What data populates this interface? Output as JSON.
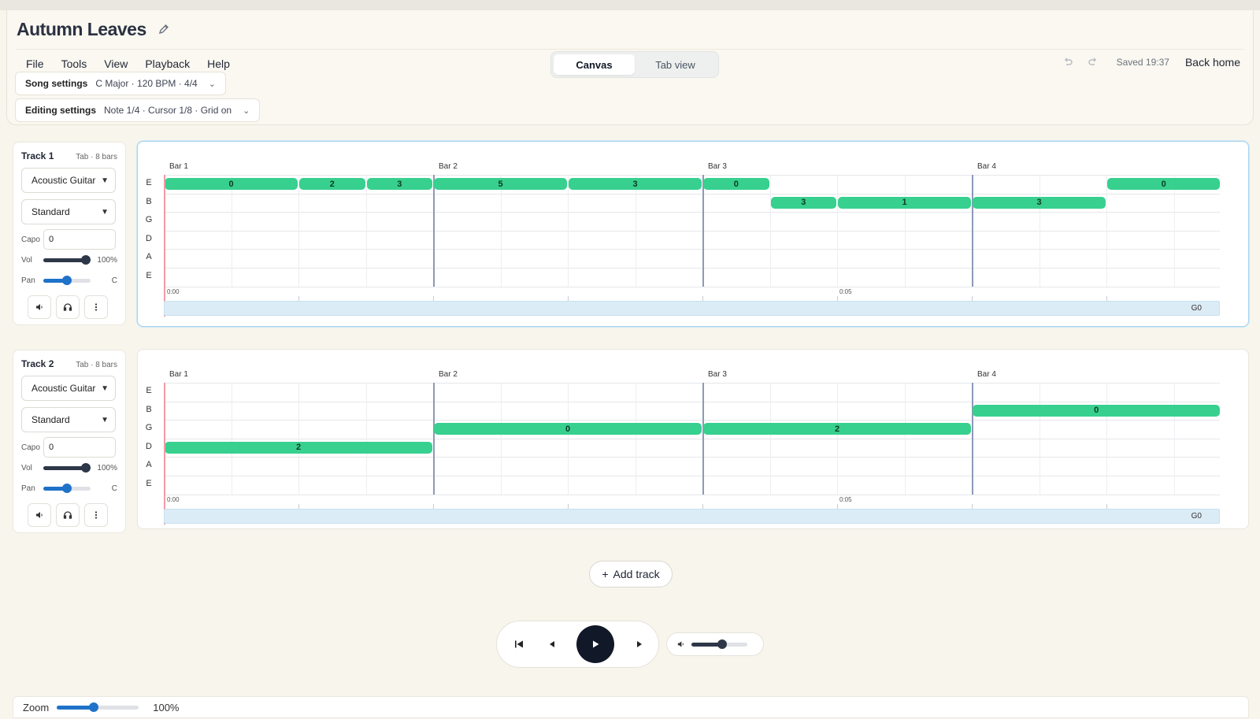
{
  "header": {
    "title": "Autumn Leaves",
    "menu": [
      "File",
      "Tools",
      "View",
      "Playback",
      "Help"
    ],
    "view_toggle": [
      "Canvas",
      "Tab view"
    ],
    "saved": "Saved 19:37",
    "back_home": "Back home"
  },
  "song_settings": {
    "label": "Song settings",
    "value": "C Major · 120 BPM · 4/4"
  },
  "editing_settings": {
    "label": "Editing settings",
    "value": "Note 1/4 · Cursor 1/8 · Grid on"
  },
  "colors": {
    "note": "#37d08f",
    "bar_line": "#8e99b5",
    "playhead": "#f19aa6",
    "accent": "#1f72c9",
    "strip": "#dcecf6"
  },
  "tracks": [
    {
      "name": "Track 1",
      "meta": "Tab · 8 bars",
      "instrument": "Acoustic Guitar",
      "tuning": "Standard",
      "capo_label": "Capo",
      "capo": "0",
      "vol_label": "Vol",
      "vol": "100%",
      "vol_level": 1.0,
      "pan_label": "Pan",
      "pan": "C",
      "pan_level": 0.5,
      "bars": [
        "Bar 1",
        "Bar 2",
        "Bar 3",
        "Bar 4"
      ],
      "strings": [
        "E",
        "B",
        "G",
        "D",
        "A",
        "E"
      ],
      "times": [
        "0:00",
        "0:05"
      ],
      "go": "G0",
      "notes": [
        {
          "string": 0,
          "start": 0,
          "len": 1,
          "fret": "0"
        },
        {
          "string": 0,
          "start": 1,
          "len": 0.5,
          "fret": "2"
        },
        {
          "string": 0,
          "start": 1.5,
          "len": 0.5,
          "fret": "3"
        },
        {
          "string": 0,
          "start": 2,
          "len": 1,
          "fret": "5"
        },
        {
          "string": 0,
          "start": 3,
          "len": 1,
          "fret": "3"
        },
        {
          "string": 0,
          "start": 4,
          "len": 0.5,
          "fret": "0"
        },
        {
          "string": 1,
          "start": 4.5,
          "len": 0.5,
          "fret": "3"
        },
        {
          "string": 1,
          "start": 5,
          "len": 1,
          "fret": "1"
        },
        {
          "string": 1,
          "start": 6,
          "len": 1,
          "fret": "3"
        },
        {
          "string": 0,
          "start": 7,
          "len": 0.85,
          "fret": "0"
        }
      ]
    },
    {
      "name": "Track 2",
      "meta": "Tab · 8 bars",
      "instrument": "Acoustic Guitar",
      "tuning": "Standard",
      "capo_label": "Capo",
      "capo": "0",
      "vol_label": "Vol",
      "vol": "100%",
      "vol_level": 1.0,
      "pan_label": "Pan",
      "pan": "C",
      "pan_level": 0.5,
      "bars": [
        "Bar 1",
        "Bar 2",
        "Bar 3",
        "Bar 4"
      ],
      "strings": [
        "E",
        "B",
        "G",
        "D",
        "A",
        "E"
      ],
      "times": [
        "0:00",
        "0:05"
      ],
      "go": "G0",
      "notes": [
        {
          "string": 3,
          "start": 0,
          "len": 2,
          "fret": "2"
        },
        {
          "string": 2,
          "start": 2,
          "len": 2,
          "fret": "0"
        },
        {
          "string": 2,
          "start": 4,
          "len": 2,
          "fret": "2"
        },
        {
          "string": 1,
          "start": 6,
          "len": 1.85,
          "fret": "0"
        }
      ]
    }
  ],
  "add_track": "Add track",
  "transport": {
    "master_volume_level": 0.55
  },
  "zoom": {
    "label": "Zoom",
    "value": "100%",
    "level": 0.45
  }
}
